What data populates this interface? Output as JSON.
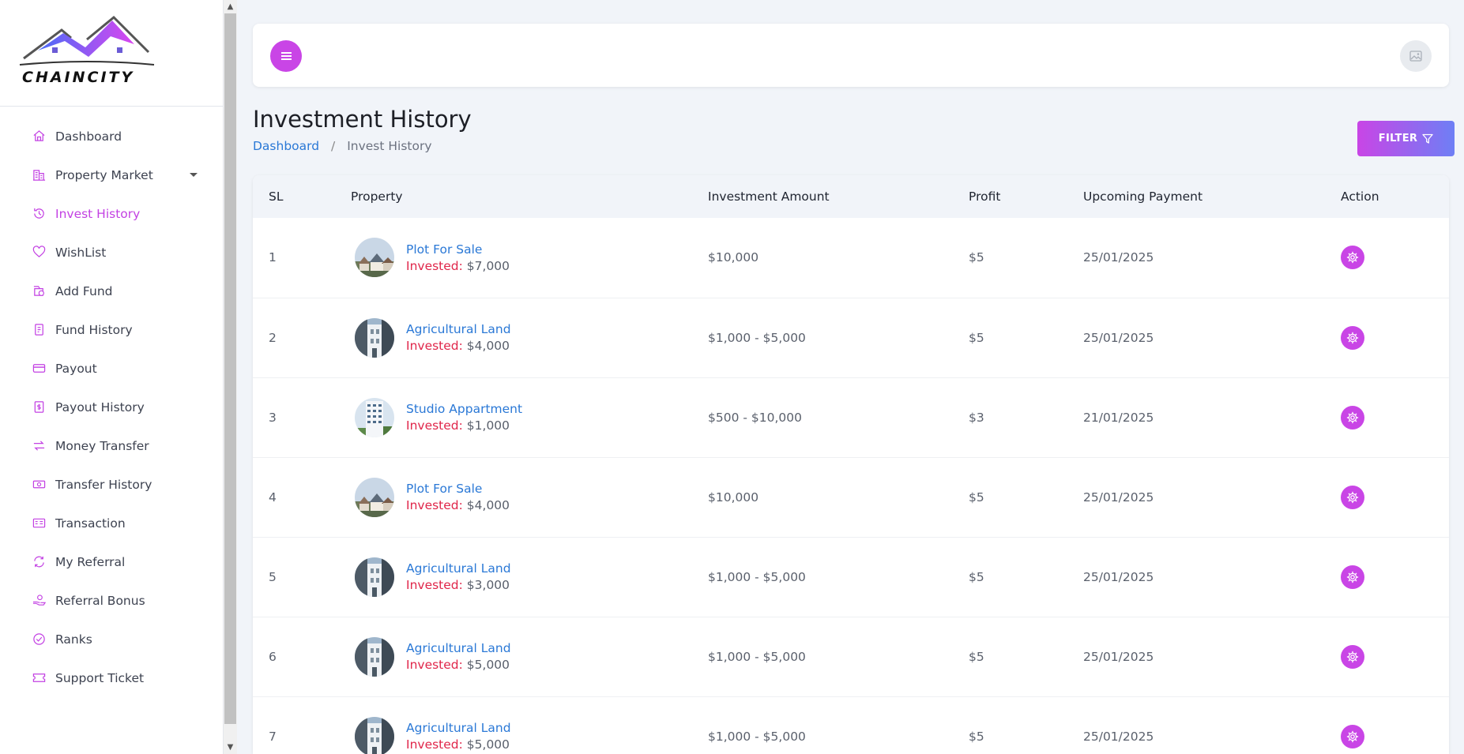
{
  "brand": {
    "name": "CHAINCITY"
  },
  "sidebar": {
    "items": [
      {
        "label": "Dashboard",
        "icon": "home-icon",
        "active": false
      },
      {
        "label": "Property Market",
        "icon": "building-icon",
        "active": false,
        "has_dropdown": true
      },
      {
        "label": "Invest History",
        "icon": "history-icon",
        "active": true
      },
      {
        "label": "WishList",
        "icon": "heart-icon",
        "active": false
      },
      {
        "label": "Add Fund",
        "icon": "add-fund-icon",
        "active": false
      },
      {
        "label": "Fund History",
        "icon": "fund-history-icon",
        "active": false
      },
      {
        "label": "Payout",
        "icon": "card-icon",
        "active": false
      },
      {
        "label": "Payout History",
        "icon": "payout-history-icon",
        "active": false
      },
      {
        "label": "Money Transfer",
        "icon": "transfer-icon",
        "active": false
      },
      {
        "label": "Transfer History",
        "icon": "cash-icon",
        "active": false
      },
      {
        "label": "Transaction",
        "icon": "receipt-icon",
        "active": false
      },
      {
        "label": "My Referral",
        "icon": "refresh-icon",
        "active": false
      },
      {
        "label": "Referral Bonus",
        "icon": "hand-coin-icon",
        "active": false
      },
      {
        "label": "Ranks",
        "icon": "badge-icon",
        "active": false
      },
      {
        "label": "Support Ticket",
        "icon": "ticket-icon",
        "active": false
      }
    ]
  },
  "header": {
    "page_title": "Investment History",
    "breadcrumb": {
      "home": "Dashboard",
      "separator": "/",
      "current": "Invest History"
    },
    "filter_label": "FILTER"
  },
  "table": {
    "columns": [
      "SL",
      "Property",
      "Investment Amount",
      "Profit",
      "Upcoming Payment",
      "Action"
    ],
    "invested_label": "Invested:",
    "rows": [
      {
        "sl": "1",
        "property": "Plot For Sale",
        "invested": "$7,000",
        "amount": "$10,000",
        "profit": "$5",
        "upcoming": "25/01/2025",
        "thumb": "houses"
      },
      {
        "sl": "2",
        "property": "Agricultural Land",
        "invested": "$4,000",
        "amount": "$1,000 - $5,000",
        "profit": "$5",
        "upcoming": "25/01/2025",
        "thumb": "street"
      },
      {
        "sl": "3",
        "property": "Studio Appartment",
        "invested": "$1,000",
        "amount": "$500 - $10,000",
        "profit": "$3",
        "upcoming": "21/01/2025",
        "thumb": "tower"
      },
      {
        "sl": "4",
        "property": "Plot For Sale",
        "invested": "$4,000",
        "amount": "$10,000",
        "profit": "$5",
        "upcoming": "25/01/2025",
        "thumb": "houses"
      },
      {
        "sl": "5",
        "property": "Agricultural Land",
        "invested": "$3,000",
        "amount": "$1,000 - $5,000",
        "profit": "$5",
        "upcoming": "25/01/2025",
        "thumb": "street"
      },
      {
        "sl": "6",
        "property": "Agricultural Land",
        "invested": "$5,000",
        "amount": "$1,000 - $5,000",
        "profit": "$5",
        "upcoming": "25/01/2025",
        "thumb": "street"
      },
      {
        "sl": "7",
        "property": "Agricultural Land",
        "invested": "$5,000",
        "amount": "$1,000 - $5,000",
        "profit": "$5",
        "upcoming": "25/01/2025",
        "thumb": "street"
      }
    ]
  },
  "colors": {
    "accent": "#c945e6",
    "link": "#2a78d6",
    "invested_label": "#e0264a"
  }
}
